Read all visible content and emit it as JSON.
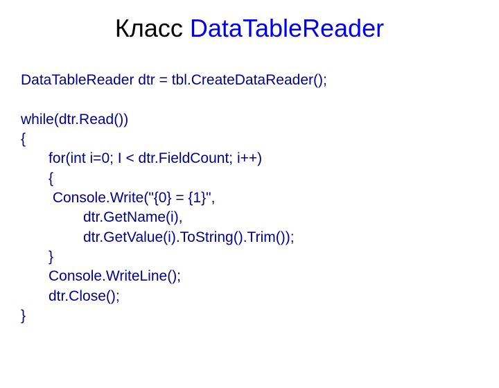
{
  "title": {
    "prefix": "Класс ",
    "highlight": "DataTableReader"
  },
  "code": {
    "line1": "DataTableReader dtr = tbl.CreateDataReader();",
    "line2": "",
    "line3": "while(dtr.Read())",
    "line4": "{",
    "line5": "for(int i=0; I < dtr.FieldCount; i++)",
    "line6": "{",
    "line7": " Console.Write(\"{0} = {1}\",",
    "line8": "dtr.GetName(i),",
    "line9": "dtr.GetValue(i).ToString().Trim());",
    "line10": "}",
    "line11": "Console.WriteLine();",
    "line12": "dtr.Close();",
    "line13": "}"
  }
}
